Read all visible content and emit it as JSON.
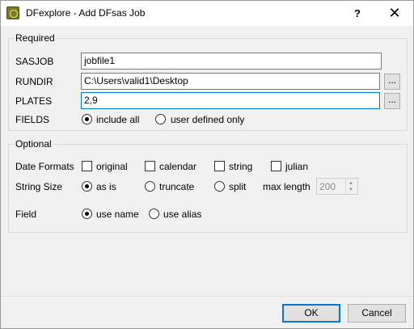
{
  "window": {
    "title": "DFexplore - Add DFsas Job",
    "help_label": "?",
    "close_label": "✕"
  },
  "required": {
    "legend": "Required",
    "sasjob": {
      "label": "SASJOB",
      "value": "jobfile1"
    },
    "rundir": {
      "label": "RUNDIR",
      "value": "C:\\Users\\valid1\\Desktop",
      "browse": "..."
    },
    "plates": {
      "label": "PLATES",
      "value": "2,9",
      "browse": "..."
    },
    "fields": {
      "label": "FIELDS",
      "options": [
        "include all",
        "user defined only"
      ],
      "selected": "include all"
    }
  },
  "optional": {
    "legend": "Optional",
    "date_formats": {
      "label": "Date Formats",
      "options": [
        "original",
        "calendar",
        "string",
        "julian"
      ],
      "checked": []
    },
    "string_size": {
      "label": "String Size",
      "options": [
        "as is",
        "truncate",
        "split"
      ],
      "selected": "as is",
      "max_length_label": "max length",
      "max_length_value": "200"
    },
    "field": {
      "label": "Field",
      "options": [
        "use name",
        "use alias"
      ],
      "selected": "use name"
    }
  },
  "footer": {
    "ok_label": "OK",
    "cancel_label": "Cancel"
  }
}
